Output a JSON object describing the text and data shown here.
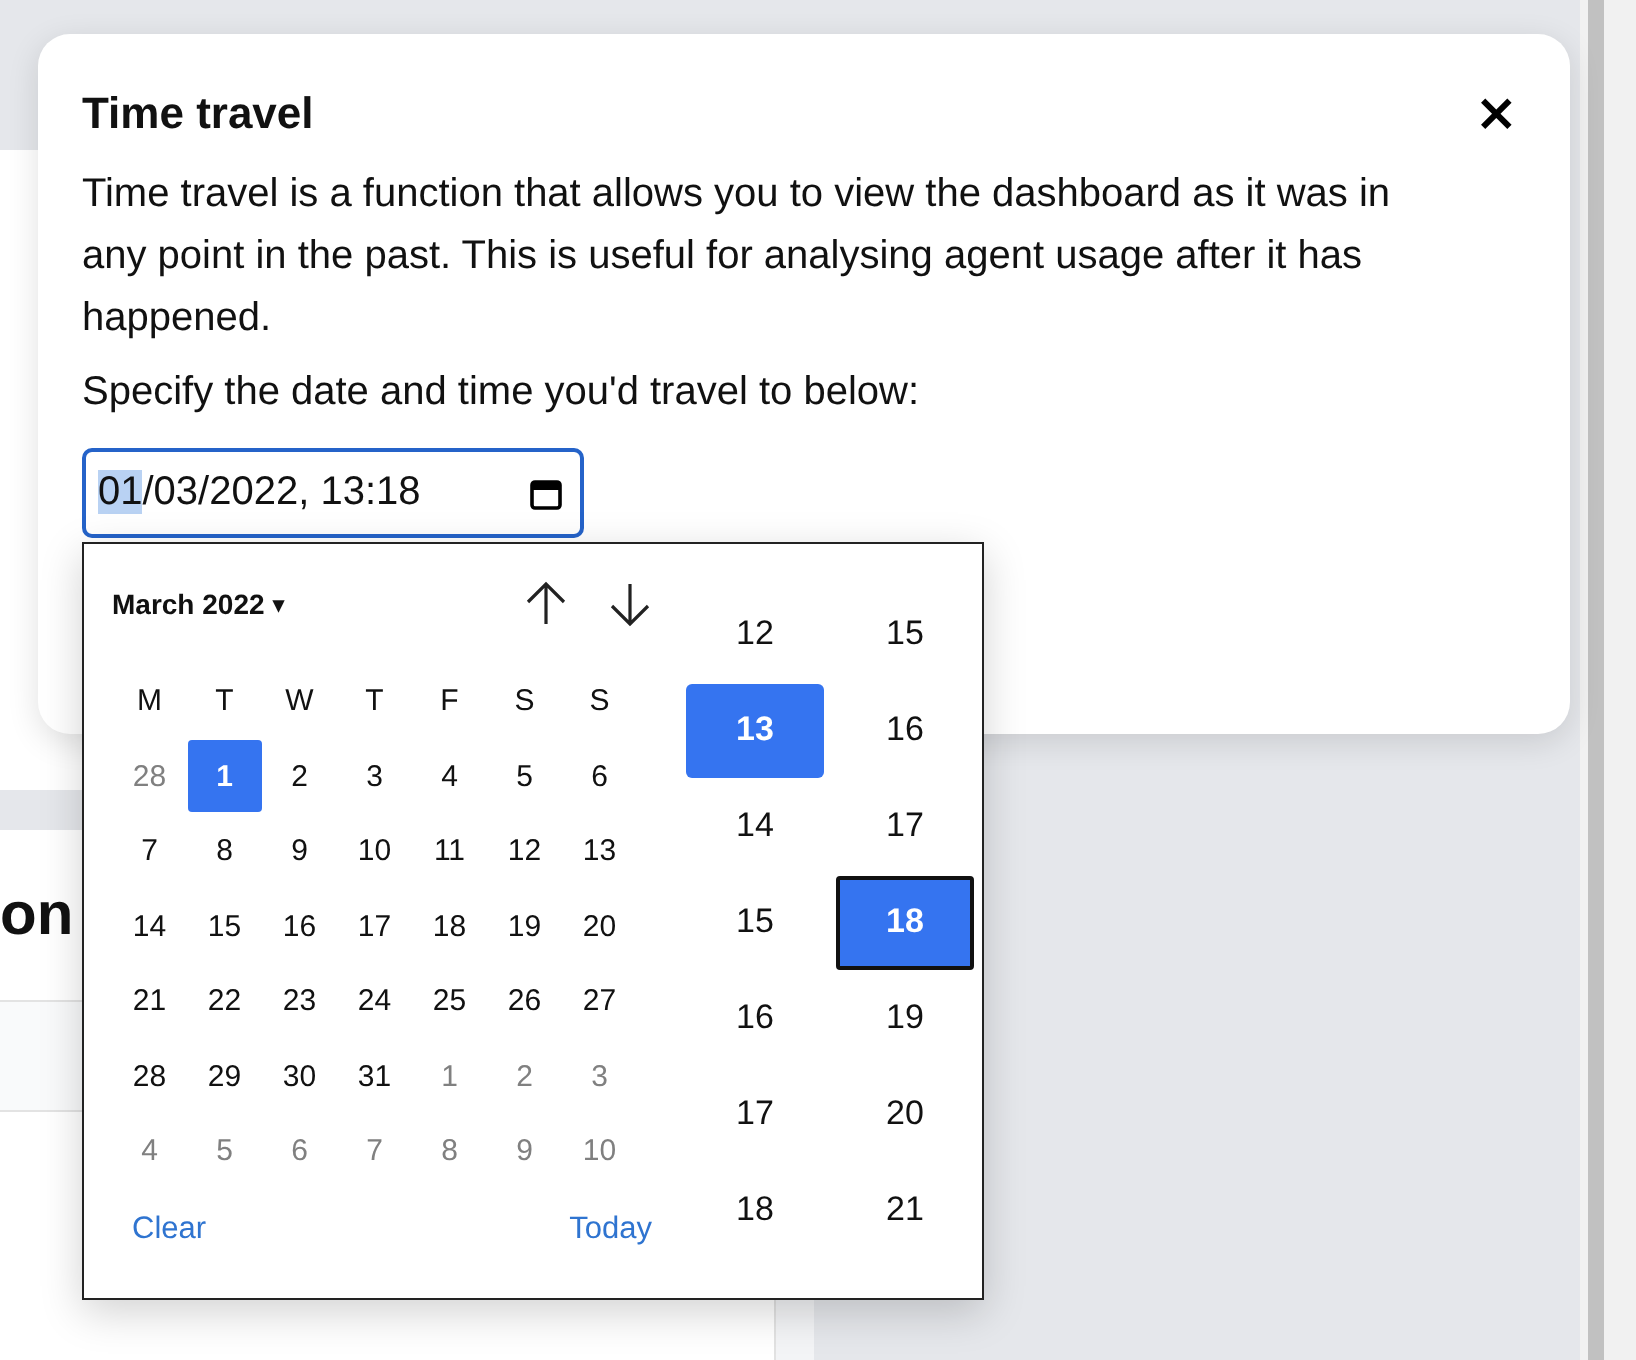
{
  "background": {
    "card_heading": "on"
  },
  "dialog": {
    "title": "Time travel",
    "close": "×",
    "description": "Time travel is a function that allows you to view the dashboard as it was in any point in the past. This is useful for analysing agent usage after it has happened.",
    "prompt": "Specify the date and time you'd travel to below:",
    "field": {
      "parts": [
        {
          "text": "01",
          "selected": true
        },
        {
          "text": "/03/2022, 13:18",
          "selected": false
        }
      ]
    }
  },
  "picker": {
    "month": "March 2022",
    "month_caret": "▾",
    "weekdays": [
      "M",
      "T",
      "W",
      "T",
      "F",
      "S",
      "S"
    ],
    "days": [
      {
        "label": "28",
        "outside": true,
        "selected": false
      },
      {
        "label": "1",
        "outside": false,
        "selected": true
      },
      {
        "label": "2",
        "outside": false,
        "selected": false
      },
      {
        "label": "3",
        "outside": false,
        "selected": false
      },
      {
        "label": "4",
        "outside": false,
        "selected": false
      },
      {
        "label": "5",
        "outside": false,
        "selected": false
      },
      {
        "label": "6",
        "outside": false,
        "selected": false
      },
      {
        "label": "7",
        "outside": false,
        "selected": false
      },
      {
        "label": "8",
        "outside": false,
        "selected": false
      },
      {
        "label": "9",
        "outside": false,
        "selected": false
      },
      {
        "label": "10",
        "outside": false,
        "selected": false
      },
      {
        "label": "11",
        "outside": false,
        "selected": false
      },
      {
        "label": "12",
        "outside": false,
        "selected": false
      },
      {
        "label": "13",
        "outside": false,
        "selected": false
      },
      {
        "label": "14",
        "outside": false,
        "selected": false
      },
      {
        "label": "15",
        "outside": false,
        "selected": false
      },
      {
        "label": "16",
        "outside": false,
        "selected": false
      },
      {
        "label": "17",
        "outside": false,
        "selected": false
      },
      {
        "label": "18",
        "outside": false,
        "selected": false
      },
      {
        "label": "19",
        "outside": false,
        "selected": false
      },
      {
        "label": "20",
        "outside": false,
        "selected": false
      },
      {
        "label": "21",
        "outside": false,
        "selected": false
      },
      {
        "label": "22",
        "outside": false,
        "selected": false
      },
      {
        "label": "23",
        "outside": false,
        "selected": false
      },
      {
        "label": "24",
        "outside": false,
        "selected": false
      },
      {
        "label": "25",
        "outside": false,
        "selected": false
      },
      {
        "label": "26",
        "outside": false,
        "selected": false
      },
      {
        "label": "27",
        "outside": false,
        "selected": false
      },
      {
        "label": "28",
        "outside": false,
        "selected": false
      },
      {
        "label": "29",
        "outside": false,
        "selected": false
      },
      {
        "label": "30",
        "outside": false,
        "selected": false
      },
      {
        "label": "31",
        "outside": false,
        "selected": false
      },
      {
        "label": "1",
        "outside": true,
        "selected": false
      },
      {
        "label": "2",
        "outside": true,
        "selected": false
      },
      {
        "label": "3",
        "outside": true,
        "selected": false
      },
      {
        "label": "4",
        "outside": true,
        "selected": false
      },
      {
        "label": "5",
        "outside": true,
        "selected": false
      },
      {
        "label": "6",
        "outside": true,
        "selected": false
      },
      {
        "label": "7",
        "outside": true,
        "selected": false
      },
      {
        "label": "8",
        "outside": true,
        "selected": false
      },
      {
        "label": "9",
        "outside": true,
        "selected": false
      },
      {
        "label": "10",
        "outside": true,
        "selected": false
      }
    ],
    "clear": "Clear",
    "today": "Today",
    "hours": [
      {
        "label": "12",
        "selected": false,
        "focused": false
      },
      {
        "label": "13",
        "selected": true,
        "focused": false
      },
      {
        "label": "14",
        "selected": false,
        "focused": false
      },
      {
        "label": "15",
        "selected": false,
        "focused": false
      },
      {
        "label": "16",
        "selected": false,
        "focused": false
      },
      {
        "label": "17",
        "selected": false,
        "focused": false
      },
      {
        "label": "18",
        "selected": false,
        "focused": false
      }
    ],
    "minutes": [
      {
        "label": "15",
        "selected": false,
        "focused": false
      },
      {
        "label": "16",
        "selected": false,
        "focused": false
      },
      {
        "label": "17",
        "selected": false,
        "focused": false
      },
      {
        "label": "18",
        "selected": true,
        "focused": true
      },
      {
        "label": "19",
        "selected": false,
        "focused": false
      },
      {
        "label": "20",
        "selected": false,
        "focused": false
      },
      {
        "label": "21",
        "selected": false,
        "focused": false
      }
    ]
  }
}
